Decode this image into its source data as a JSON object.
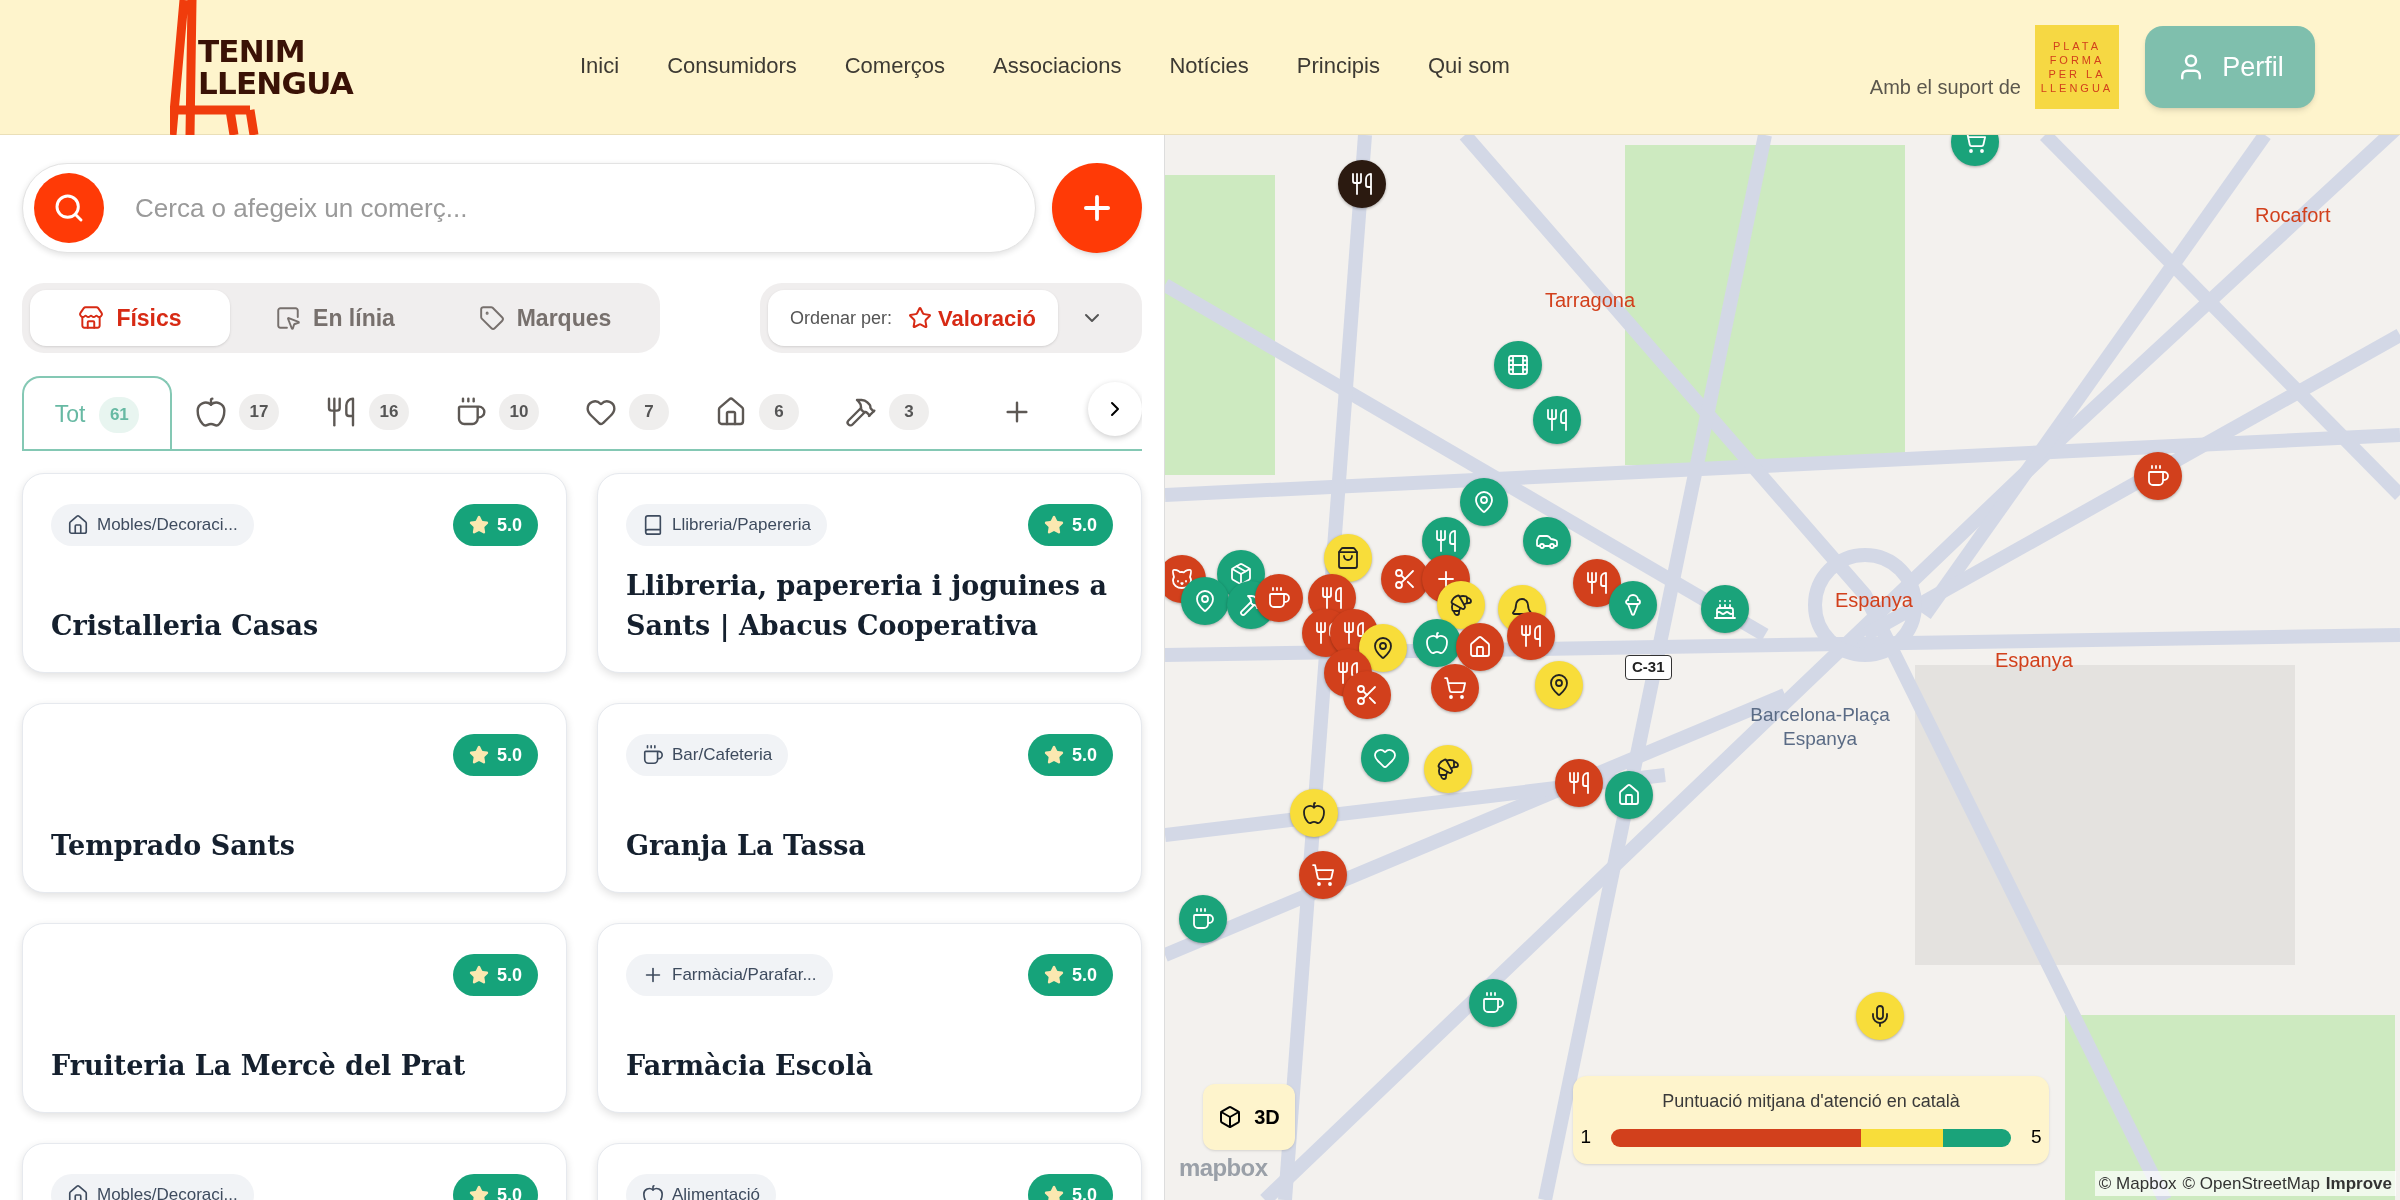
{
  "header": {
    "logo_lines": [
      "TENIM",
      "LLENGUA"
    ],
    "nav": [
      {
        "label": "Inici"
      },
      {
        "label": "Consumidors"
      },
      {
        "label": "Comerços"
      },
      {
        "label": "Associacions"
      },
      {
        "label": "Notícies"
      },
      {
        "label": "Principis"
      },
      {
        "label": "Qui som"
      }
    ],
    "support_text": "Amb el suport de",
    "partner_logo_lines": [
      "PLATA",
      "FORMA",
      "PER LA",
      "LLENGUA"
    ],
    "profile_button": "Perfil"
  },
  "search": {
    "placeholder": "Cerca o afegeix un comerç..."
  },
  "view_tabs": [
    {
      "kind": "store",
      "label": "Físics",
      "selected": true
    },
    {
      "kind": "online",
      "label": "En línia",
      "selected": false
    },
    {
      "kind": "tag",
      "label": "Marques",
      "selected": false
    }
  ],
  "sort": {
    "label": "Ordenar per:",
    "value": "Valoració"
  },
  "categories": [
    {
      "kind": "all",
      "label": "Tot",
      "count": "61",
      "selected": true
    },
    {
      "kind": "apple",
      "count": "17",
      "selected": false
    },
    {
      "kind": "fork",
      "count": "16",
      "selected": false
    },
    {
      "kind": "coffee",
      "count": "10",
      "selected": false
    },
    {
      "kind": "heart",
      "count": "7",
      "selected": false
    },
    {
      "kind": "house",
      "count": "6",
      "selected": false
    },
    {
      "kind": "hammer",
      "count": "3",
      "selected": false
    },
    {
      "kind": "plus",
      "selected": false
    }
  ],
  "cards": [
    {
      "category": {
        "kind": "house",
        "label": "Mobles/Decoraci..."
      },
      "rating": "5.0",
      "title": "Cristalleria Casas"
    },
    {
      "category": {
        "kind": "book",
        "label": "Llibreria/Papereria"
      },
      "rating": "5.0",
      "title": "Llibreria, papereria i joguines a Sants | Abacus Cooperativa"
    },
    {
      "rating": "5.0",
      "title": "Temprado Sants"
    },
    {
      "category": {
        "kind": "coffee",
        "label": "Bar/Cafeteria"
      },
      "rating": "5.0",
      "title": "Granja La Tassa"
    },
    {
      "rating": "5.0",
      "title": "Fruiteria La Mercè del Prat"
    },
    {
      "category": {
        "kind": "plus",
        "label": "Farmàcia/Parafar..."
      },
      "rating": "5.0",
      "title": "Farmàcia Escolà"
    },
    {
      "category": {
        "kind": "house",
        "label": "Mobles/Decoraci..."
      },
      "rating": "5.0"
    },
    {
      "category": {
        "kind": "apple",
        "label": "Alimentació"
      },
      "rating": "5.0"
    }
  ],
  "map": {
    "labels": [
      {
        "kind": "station",
        "text": "Tarragona"
      },
      {
        "kind": "station",
        "text": "Rocafort"
      },
      {
        "kind": "station",
        "text": "Espanya"
      },
      {
        "kind": "station",
        "text": "Espanya"
      },
      {
        "kind": "place",
        "text": "Barcelona-Plaça Espanya"
      },
      {
        "kind": "road",
        "text": "C-31"
      }
    ],
    "markers": [
      {
        "kind": "fork",
        "color": "#2b1a10"
      },
      {
        "kind": "cart",
        "color": "#1aa37a"
      },
      {
        "kind": "film",
        "color": "#1aa37a"
      },
      {
        "kind": "fork",
        "color": "#1aa37a"
      },
      {
        "kind": "coffee",
        "color": "#d2401c"
      },
      {
        "kind": "pin",
        "color": "#1aa37a"
      },
      {
        "kind": "car",
        "color": "#1aa37a"
      },
      {
        "kind": "fork",
        "color": "#1aa37a"
      },
      {
        "kind": "bag",
        "color": "#f8dd3a"
      },
      {
        "kind": "cat",
        "color": "#d2401c"
      },
      {
        "kind": "box",
        "color": "#1aa37a"
      },
      {
        "kind": "pin",
        "color": "#1aa37a"
      },
      {
        "kind": "hammer",
        "color": "#1aa37a"
      },
      {
        "kind": "coffee",
        "color": "#d2401c"
      },
      {
        "kind": "fork",
        "color": "#d2401c"
      },
      {
        "kind": "scissors",
        "color": "#d2401c"
      },
      {
        "kind": "plus",
        "color": "#d2401c"
      },
      {
        "kind": "croissant",
        "color": "#f8dd3a"
      },
      {
        "kind": "fork",
        "color": "#d2401c"
      },
      {
        "kind": "icecream",
        "color": "#1aa37a"
      },
      {
        "kind": "cake",
        "color": "#1aa37a"
      },
      {
        "kind": "fork",
        "color": "#d2401c"
      },
      {
        "kind": "fork",
        "color": "#d2401c"
      },
      {
        "kind": "pin",
        "color": "#f8dd3a"
      },
      {
        "kind": "apple",
        "color": "#1aa37a"
      },
      {
        "kind": "bell",
        "color": "#f8dd3a"
      },
      {
        "kind": "house",
        "color": "#d2401c"
      },
      {
        "kind": "fork",
        "color": "#d2401c"
      },
      {
        "kind": "fork",
        "color": "#d2401c"
      },
      {
        "kind": "scissors",
        "color": "#d2401c"
      },
      {
        "kind": "cart",
        "color": "#d2401c"
      },
      {
        "kind": "pin",
        "color": "#f8dd3a"
      },
      {
        "kind": "heart",
        "color": "#1aa37a"
      },
      {
        "kind": "croissant",
        "color": "#f8dd3a"
      },
      {
        "kind": "fork",
        "color": "#d2401c"
      },
      {
        "kind": "house",
        "color": "#1aa37a"
      },
      {
        "kind": "apple",
        "color": "#f8dd3a"
      },
      {
        "kind": "cart",
        "color": "#d2401c"
      },
      {
        "kind": "coffee",
        "color": "#1aa37a"
      },
      {
        "kind": "coffee",
        "color": "#1aa37a"
      },
      {
        "kind": "mic",
        "color": "#f8dd3a"
      }
    ],
    "button_3d": "3D",
    "legend": {
      "title": "Puntuació mitjana d'atenció en català",
      "min": "1",
      "max": "5"
    },
    "mapbox_logo": "mapbox",
    "attribution": [
      "© Mapbox",
      "© OpenStreetMap",
      "Improve"
    ]
  }
}
